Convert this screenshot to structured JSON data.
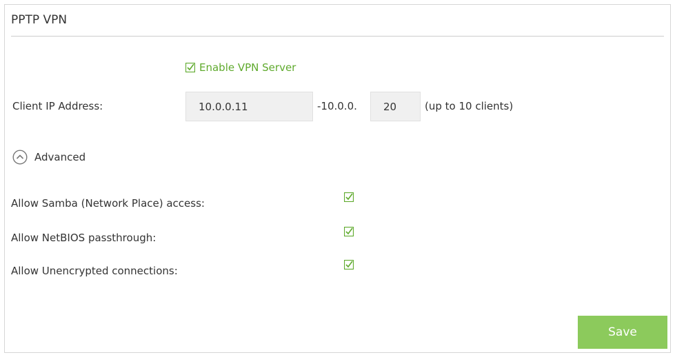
{
  "panel": {
    "title": "PPTP VPN"
  },
  "enable_vpn": {
    "label": "Enable VPN Server",
    "checked": true
  },
  "client_ip": {
    "label": "Client IP Address:",
    "start_value": "10.0.0.11",
    "range_prefix": "-10.0.0.",
    "end_value": "20",
    "hint": "(up to 10 clients)"
  },
  "advanced": {
    "label": "Advanced",
    "icon": "chevron-up-circle-icon",
    "expanded": true
  },
  "options": [
    {
      "label": "Allow Samba (Network Place) access:",
      "checked": true
    },
    {
      "label": "Allow NetBIOS passthrough:",
      "checked": true
    },
    {
      "label": "Allow Unencrypted connections:",
      "checked": true
    }
  ],
  "actions": {
    "save_label": "Save"
  },
  "colors": {
    "accent_green": "#5faa2d",
    "button_green": "#8cca5c",
    "field_bg": "#f0f0f0",
    "border": "#d6d6d6"
  }
}
